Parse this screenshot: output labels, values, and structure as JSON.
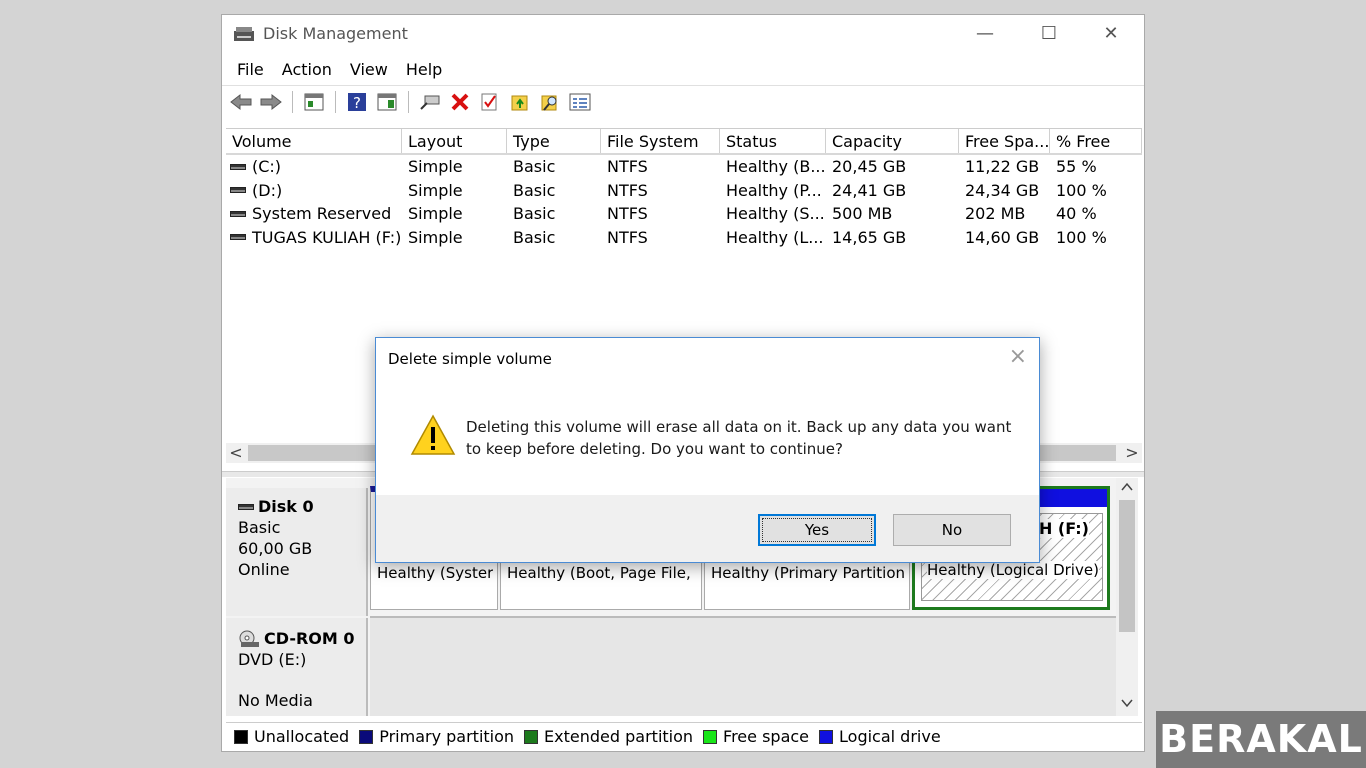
{
  "window": {
    "title": "Disk Management",
    "controls": {
      "minimize": "—",
      "maximize": "☐",
      "close": "✕"
    }
  },
  "menu": [
    "File",
    "Action",
    "View",
    "Help"
  ],
  "toolbar_icons": [
    "back-arrow-icon",
    "forward-arrow-icon",
    "console-tree-icon",
    "help-icon",
    "properties-icon",
    "connect-icon",
    "delete-icon",
    "check-icon",
    "folder-up-icon",
    "search-folder-icon",
    "list-view-icon"
  ],
  "volume_table": {
    "columns": [
      "Volume",
      "Layout",
      "Type",
      "File System",
      "Status",
      "Capacity",
      "Free Spa...",
      "% Free"
    ],
    "rows": [
      [
        "(C:)",
        "Simple",
        "Basic",
        "NTFS",
        "Healthy (B...",
        "20,45 GB",
        "11,22 GB",
        "55 %"
      ],
      [
        "(D:)",
        "Simple",
        "Basic",
        "NTFS",
        "Healthy (P...",
        "24,41 GB",
        "24,34 GB",
        "100 %"
      ],
      [
        "System Reserved",
        "Simple",
        "Basic",
        "NTFS",
        "Healthy (S...",
        "500 MB",
        "202 MB",
        "40 %"
      ],
      [
        "TUGAS KULIAH (F:)",
        "Simple",
        "Basic",
        "NTFS",
        "Healthy (L...",
        "14,65 GB",
        "14,60 GB",
        "100 %"
      ]
    ]
  },
  "scroll_arrows": {
    "left": "<",
    "right": ">",
    "up": "^",
    "down": "v"
  },
  "disks": {
    "disk0": {
      "name": "Disk 0",
      "type": "Basic",
      "size": "60,00 GB",
      "state": "Online"
    },
    "cdrom0": {
      "name": "CD-ROM 0",
      "type": "DVD (E:)",
      "state": "No Media"
    }
  },
  "partitions": {
    "p1_status": "Healthy (Syster",
    "p2_status": "Healthy (Boot, Page File,",
    "p3_status": "Healthy (Primary Partition",
    "logical_name": "H (F:)",
    "logical_status": "Healthy (Logical Drive)"
  },
  "legend": [
    {
      "label": "Unallocated",
      "color": "#000000"
    },
    {
      "label": "Primary partition",
      "color": "#0a0a7a"
    },
    {
      "label": "Extended partition",
      "color": "#1d7a1d"
    },
    {
      "label": "Free space",
      "color": "#19e619"
    },
    {
      "label": "Logical drive",
      "color": "#1010e0"
    }
  ],
  "dialog": {
    "title": "Delete simple volume",
    "close": "×",
    "message_line1": "Deleting this volume will erase all data on it. Back up any data you want",
    "message_line2": "to keep before deleting. Do you want to continue?",
    "yes": "Yes",
    "no": "No"
  },
  "brand": "BERAKAL"
}
